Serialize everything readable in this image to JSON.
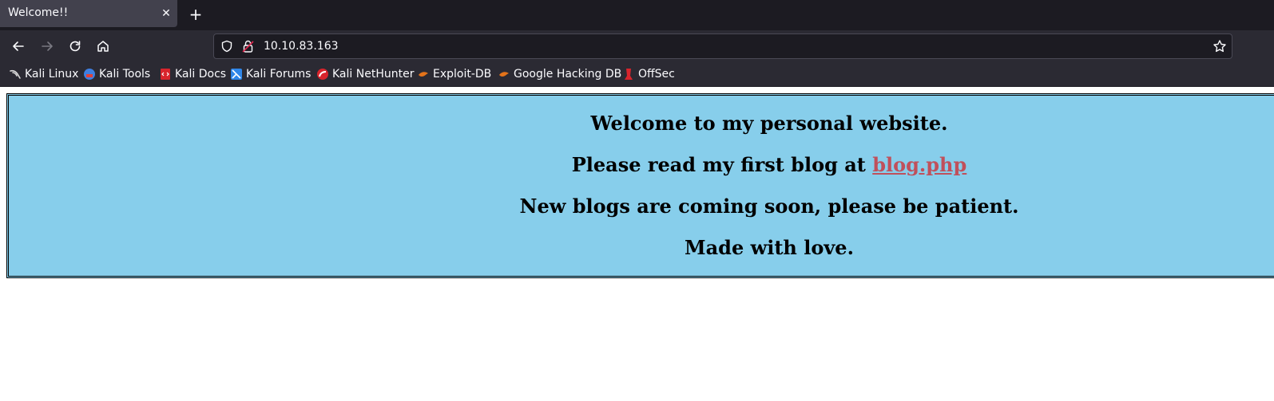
{
  "browser": {
    "tab": {
      "title": "Welcome!!"
    },
    "url": "10.10.83.163",
    "bookmarks": [
      {
        "label": "Kali Linux",
        "icon": "kali-linux-icon"
      },
      {
        "label": "Kali Tools",
        "icon": "kali-tools-icon"
      },
      {
        "label": "Kali Docs",
        "icon": "kali-docs-icon"
      },
      {
        "label": "Kali Forums",
        "icon": "kali-forums-icon"
      },
      {
        "label": "Kali NetHunter",
        "icon": "kali-nethunter-icon"
      },
      {
        "label": "Exploit-DB",
        "icon": "exploit-db-icon"
      },
      {
        "label": "Google Hacking DB",
        "icon": "ghdb-icon"
      },
      {
        "label": "OffSec",
        "icon": "offsec-icon"
      }
    ]
  },
  "page": {
    "line1": "Welcome to my personal website.",
    "line2_prefix": "Please read my first blog at ",
    "line2_link": "blog.php",
    "line3": "New blogs are coming soon, please be patient.",
    "line4": "Made with love.",
    "colors": {
      "banner_bg": "#87ceeb",
      "link": "#c0505b"
    }
  }
}
